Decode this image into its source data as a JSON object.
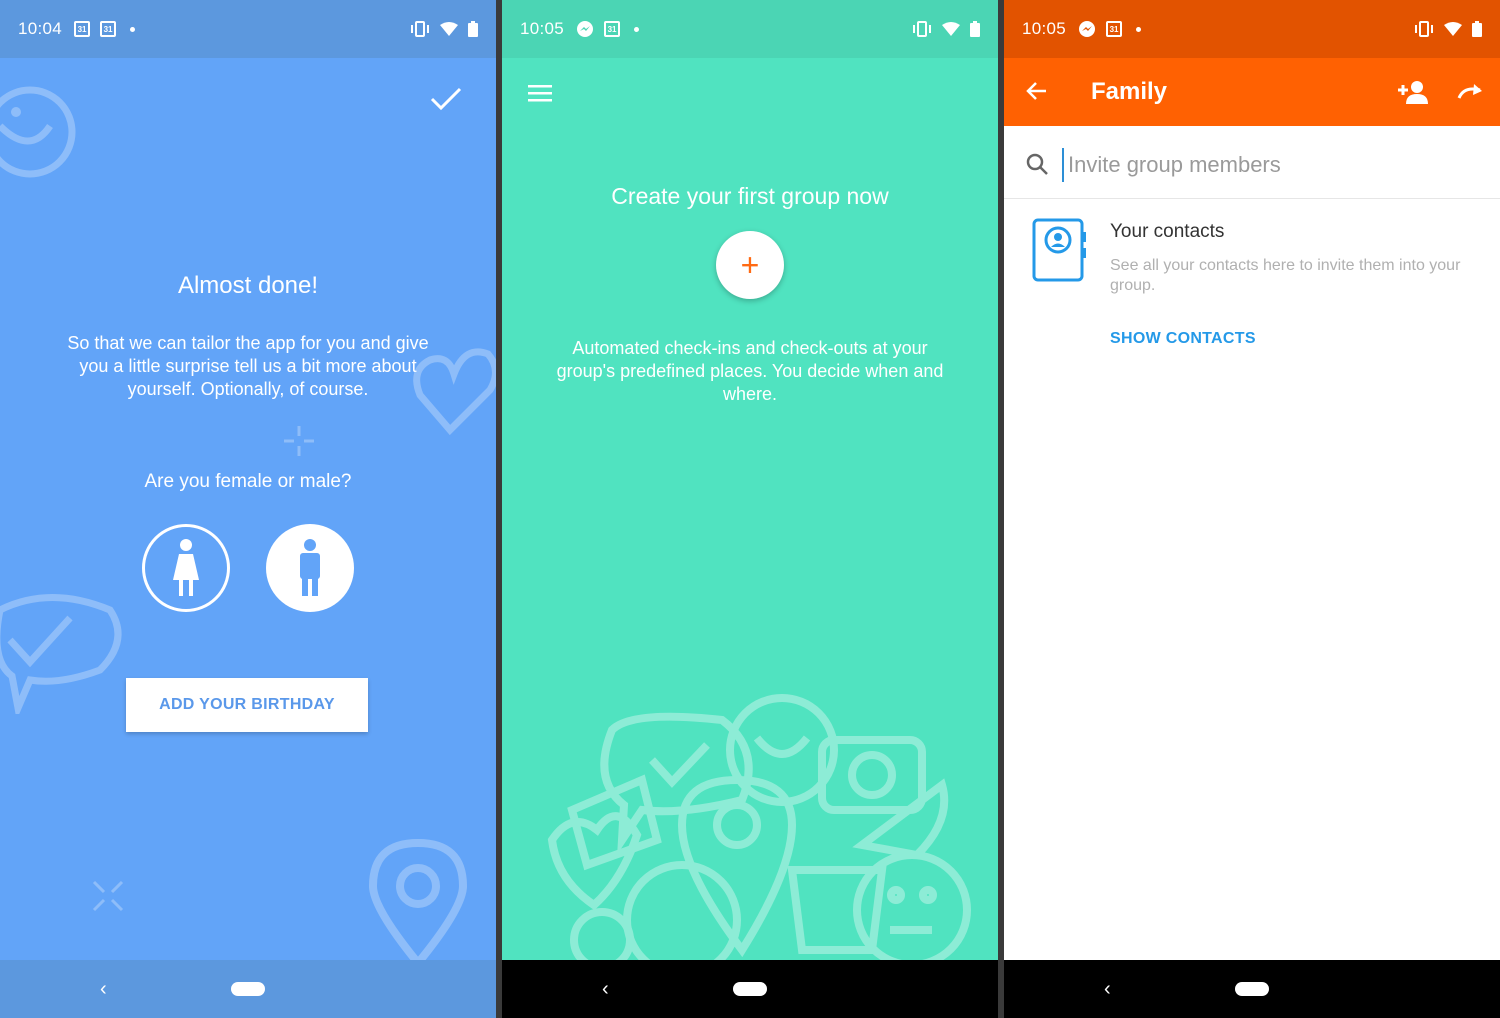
{
  "screen1": {
    "status": {
      "time": "10:04",
      "cal1": "31",
      "cal2": "31"
    },
    "title": "Almost done!",
    "description": "So that we can tailor the app for you and give you a little surprise tell us a bit more about yourself. Optionally, of course.",
    "question": "Are you female or male?",
    "birthday_button": "ADD YOUR BIRTHDAY",
    "colors": {
      "background": "#62a4f8",
      "accent": "#5a98ea"
    }
  },
  "screen2": {
    "status": {
      "time": "10:05",
      "cal": "31"
    },
    "title": "Create your first group now",
    "fab_label": "+",
    "description": "Automated check-ins and check-outs at your group's predefined places. You decide when and where.",
    "colors": {
      "background": "#50e3c0",
      "fab_icon": "#ff6a13"
    }
  },
  "screen3": {
    "status": {
      "time": "10:05",
      "cal": "31"
    },
    "appbar": {
      "title": "Family"
    },
    "search": {
      "placeholder": "Invite group members",
      "value": ""
    },
    "contacts": {
      "title": "Your contacts",
      "description": "See all your contacts here to invite them into your group.",
      "button": "SHOW CONTACTS"
    },
    "colors": {
      "appbar": "#ff6102",
      "link": "#2499e8"
    }
  },
  "nav": {
    "back_glyph": "‹"
  }
}
